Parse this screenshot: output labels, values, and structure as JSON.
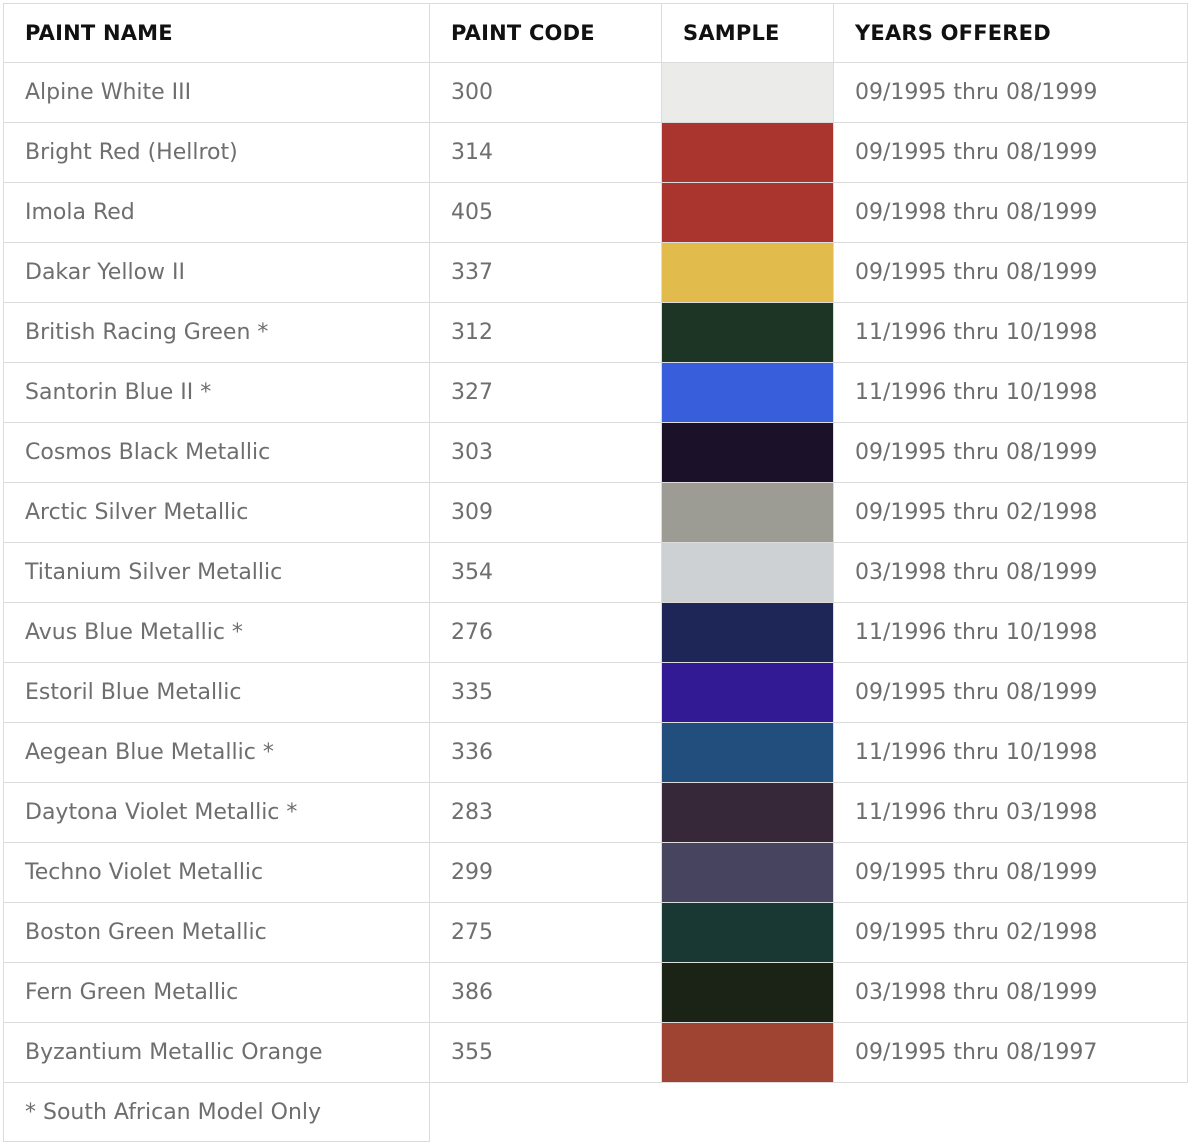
{
  "table": {
    "headers": {
      "name": "PAINT NAME",
      "code": "PAINT CODE",
      "sample": "SAMPLE",
      "years": "YEARS OFFERED"
    },
    "rows": [
      {
        "name": "Alpine White III",
        "code": "300",
        "color": "#ebebea",
        "years": "09/1995 thru 08/1999"
      },
      {
        "name": "Bright Red (Hellrot)",
        "code": "314",
        "color": "#a9352e",
        "years": "09/1995 thru 08/1999"
      },
      {
        "name": "Imola Red",
        "code": "405",
        "color": "#a9352e",
        "years": "09/1998 thru 08/1999"
      },
      {
        "name": "Dakar Yellow II",
        "code": "337",
        "color": "#e2bb4d",
        "years": "09/1995 thru 08/1999"
      },
      {
        "name": "British Racing Green *",
        "code": "312",
        "color": "#1c3525",
        "years": "11/1996 thru 10/1998"
      },
      {
        "name": "Santorin Blue II *",
        "code": "327",
        "color": "#385edb",
        "years": "11/1996 thru 10/1998"
      },
      {
        "name": "Cosmos Black Metallic",
        "code": "303",
        "color": "#1b1229",
        "years": "09/1995 thru 08/1999"
      },
      {
        "name": "Arctic Silver Metallic",
        "code": "309",
        "color": "#9c9c94",
        "years": "09/1995 thru 02/1998"
      },
      {
        "name": "Titanium Silver Metallic",
        "code": "354",
        "color": "#cdd1d4",
        "years": "03/1998 thru 08/1999"
      },
      {
        "name": "Avus Blue Metallic *",
        "code": "276",
        "color": "#1e2657",
        "years": "11/1996 thru 10/1998"
      },
      {
        "name": "Estoril Blue Metallic",
        "code": "335",
        "color": "#311a93",
        "years": "09/1995 thru 08/1999"
      },
      {
        "name": "Aegean Blue Metallic *",
        "code": "336",
        "color": "#224e7e",
        "years": "11/1996 thru 10/1998"
      },
      {
        "name": "Daytona Violet Metallic *",
        "code": "283",
        "color": "#372839",
        "years": "11/1996 thru 03/1998"
      },
      {
        "name": "Techno Violet Metallic",
        "code": "299",
        "color": "#474460",
        "years": "09/1995 thru 08/1999"
      },
      {
        "name": "Boston Green Metallic",
        "code": "275",
        "color": "#193833",
        "years": "09/1995 thru 02/1998"
      },
      {
        "name": "Fern Green Metallic",
        "code": "386",
        "color": "#1b2316",
        "years": "03/1998 thru 08/1999"
      },
      {
        "name": "Byzantium Metallic Orange",
        "code": "355",
        "color": "#9f4332",
        "years": "09/1995 thru 08/1997"
      }
    ],
    "footnote": "* South African Model Only"
  }
}
